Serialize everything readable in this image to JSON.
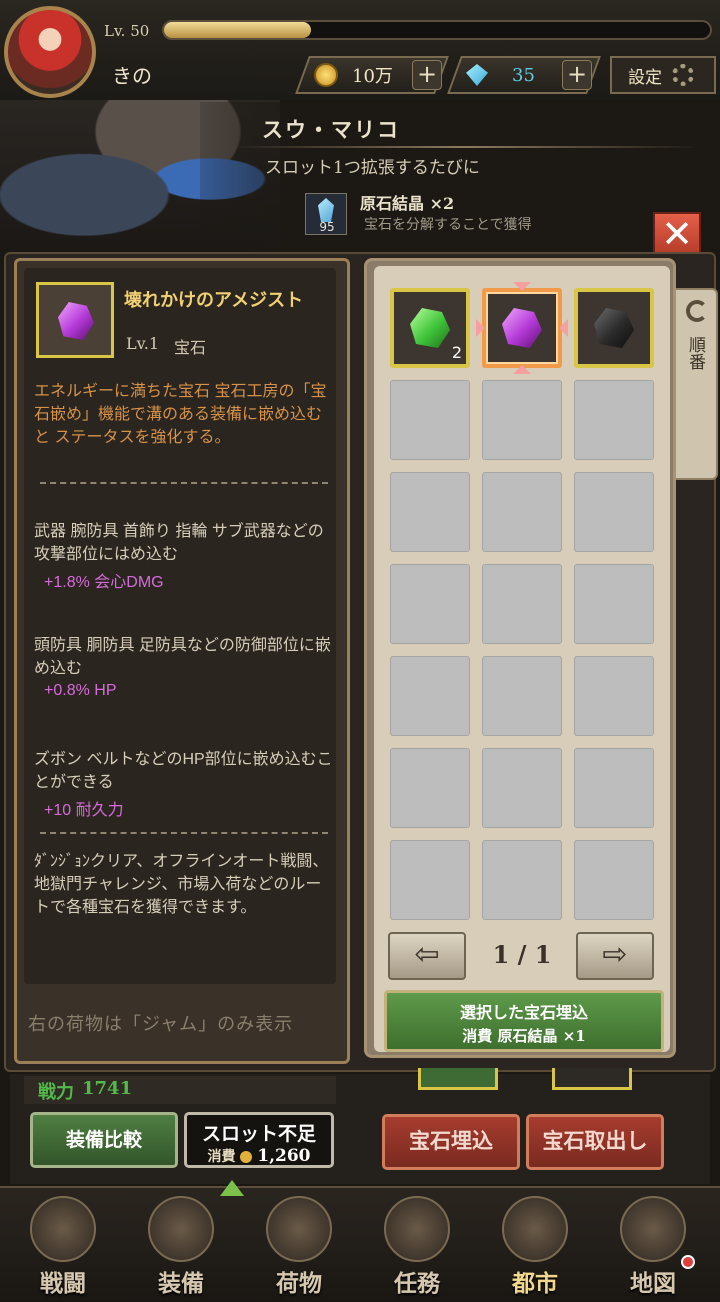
{
  "header": {
    "level_label": "Lv. 50",
    "exp_fraction": 0.27,
    "player_name": "きの",
    "gold": "10万",
    "gems": "35",
    "settings_label": "設定"
  },
  "hint": {
    "npc_name": "スウ・マリコ",
    "text": "スロット1つ拡張するたびに",
    "reward_icon_count": "95",
    "reward_name": "原石結晶 ×2",
    "reward_desc": "宝石を分解することで獲得"
  },
  "item": {
    "name": "壊れかけのアメジスト",
    "level": "Lv.1",
    "type": "宝石",
    "description": "エネルギーに満ちた宝石 宝石工房の「宝石嵌め」機能で溝のある装備に嵌め込むと ステータスを強化する。",
    "slots": [
      {
        "desc": "武器 腕防具 首飾り 指輪 サブ武器などの攻撃部位にはめ込む",
        "bonus": "+1.8% 会心DMG"
      },
      {
        "desc": "頭防具 胴防具 足防具などの防御部位に嵌め込む",
        "bonus": "+0.8% HP"
      },
      {
        "desc": "ズボン ベルトなどのHP部位に嵌め込むことができる",
        "bonus": "+10 耐久力"
      }
    ],
    "source": "ﾀﾞﾝｼﾞｮﾝクリア、オフラインオート戦闘、地獄門チャレンジ、市場入荷などのルートで各種宝石を獲得できます。",
    "filter_note": "右の荷物は「ジャム」のみ表示"
  },
  "inventory": {
    "sort_label": "順番",
    "gems": [
      {
        "icon": "green-gem-icon",
        "color": "#3fc43a",
        "count": "2"
      },
      {
        "icon": "purple-gem-icon",
        "color": "#b339d6",
        "count": ""
      },
      {
        "icon": "black-gem-icon",
        "color": "#2a2a2a",
        "count": ""
      }
    ],
    "selected_index": 1,
    "empty_slot_count": 18,
    "page": "1 / 1",
    "embed_selected_label": "選択した宝石埋込",
    "embed_selected_cost": "消費 原石結晶 ×1"
  },
  "actions": {
    "power_label": "戦力",
    "power_value": "1741",
    "compare_label": "装備比較",
    "shortage_label": "スロット不足",
    "shortage_cost_prefix": "消費",
    "shortage_cost": "1,260",
    "embed_label": "宝石埋込",
    "remove_label": "宝石取出し"
  },
  "nav": [
    {
      "label": "戦闘",
      "icon": "crossed-swords-icon"
    },
    {
      "label": "装備",
      "icon": "helmet-icon"
    },
    {
      "label": "荷物",
      "icon": "backpack-icon"
    },
    {
      "label": "任務",
      "icon": "scroll-icon"
    },
    {
      "label": "都市",
      "icon": "castle-tower-icon"
    },
    {
      "label": "地図",
      "icon": "map-icon"
    }
  ],
  "colors": {
    "accent_gold": "#f0d072",
    "bonus_purple": "#d56bda",
    "desc_orange": "#d59248",
    "power_green": "#53b94a",
    "action_red": "#a63c2e"
  }
}
